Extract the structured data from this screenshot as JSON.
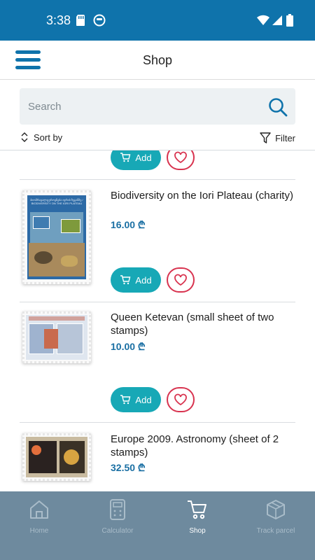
{
  "status_bar": {
    "time": "3:38"
  },
  "header": {
    "title": "Shop"
  },
  "search": {
    "placeholder": "Search"
  },
  "toolbar": {
    "sort_label": "Sort by",
    "filter_label": "Filter"
  },
  "colors": {
    "primary": "#0f73ab",
    "accent": "#17a8b6",
    "favorite": "#d8334f",
    "nav_bg": "#6e8a9e"
  },
  "products": [
    {
      "title": "",
      "price": "",
      "add_label": "Add"
    },
    {
      "title": "Biodiversity on the Iori Plateau (charity)",
      "price": "16.00 ₾",
      "add_label": "Add",
      "stamp_text": "ბიომრავალფეროვნება ივრის ზეგანზე / BIODIVERSITY ON THE IORI PLATEAU"
    },
    {
      "title": "Queen Ketevan (small sheet of two stamps)",
      "price": "10.00 ₾",
      "add_label": "Add"
    },
    {
      "title": "Europe 2009. Astronomy (sheet of 2 stamps)",
      "price": "32.50 ₾",
      "add_label": "Add"
    }
  ],
  "bottom_nav": [
    {
      "label": "Home",
      "icon": "home-icon"
    },
    {
      "label": "Calculator",
      "icon": "calculator-icon"
    },
    {
      "label": "Shop",
      "icon": "cart-icon",
      "active": true
    },
    {
      "label": "Track parcel",
      "icon": "parcel-icon"
    }
  ]
}
